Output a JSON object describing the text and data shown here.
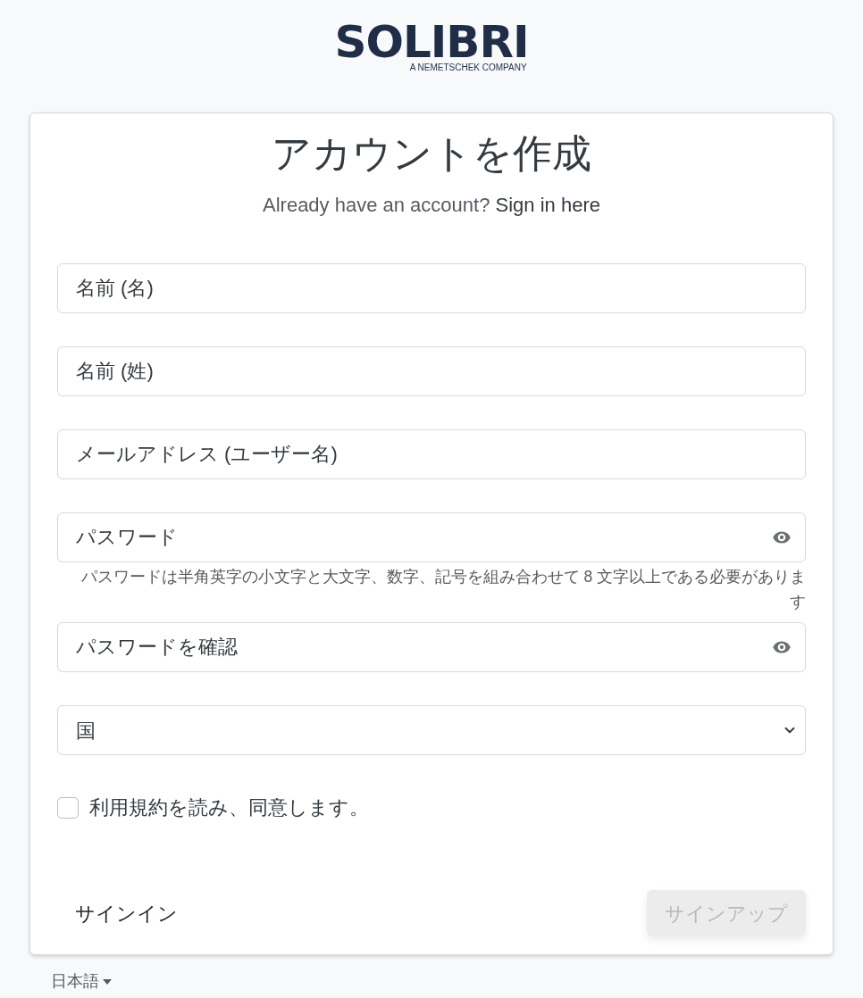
{
  "logo": {
    "name": "SOLIBRI",
    "tagline": "A NEMETSCHEK COMPANY"
  },
  "title": "アカウントを作成",
  "signin_prompt": {
    "text": "Already have an account?",
    "link": "Sign in here"
  },
  "fields": [
    {
      "kind": "text",
      "placeholder": "名前 (名)"
    },
    {
      "kind": "text",
      "placeholder": "名前 (姓)"
    },
    {
      "kind": "text",
      "placeholder": "メールアドレス (ユーザー名)"
    },
    {
      "kind": "password",
      "placeholder": "パスワード",
      "hint": "パスワードは半角英字の小文字と大文字、数字、記号を組み合わせて 8 文字以上である必要があります"
    },
    {
      "kind": "password",
      "placeholder": "パスワードを確認"
    },
    {
      "kind": "select",
      "placeholder": "国"
    }
  ],
  "terms": {
    "label": "利用規約を読み、同意します。",
    "checked": false
  },
  "signin_button": "サインイン",
  "signup_button": {
    "label": "サインアップ",
    "disabled": true
  },
  "language": "日本語"
}
